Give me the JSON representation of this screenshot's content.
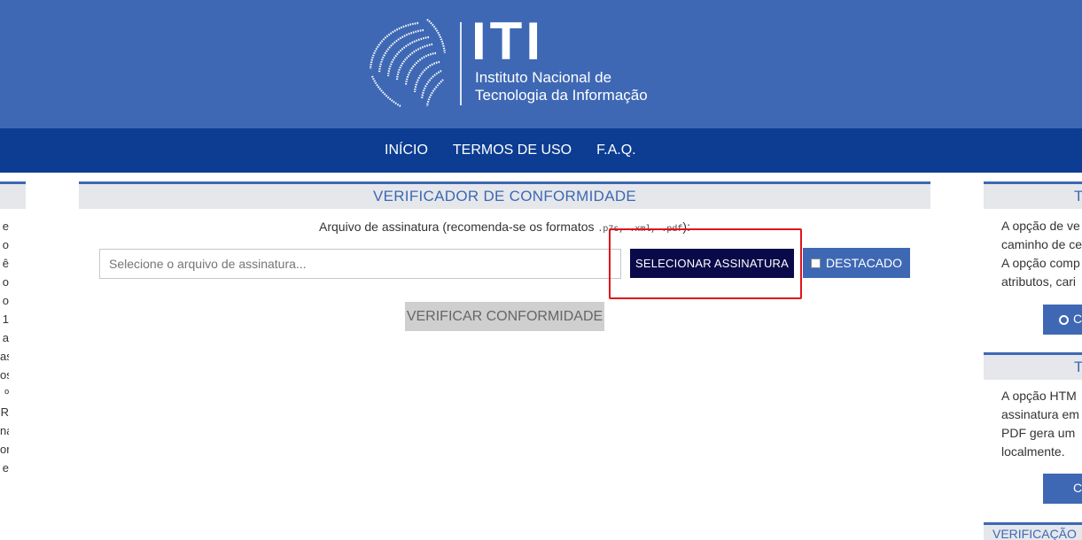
{
  "header": {
    "logo_text": "ITI",
    "logo_subtitle_line1": "Instituto Nacional de",
    "logo_subtitle_line2": "Tecnologia da Informação",
    "bg_color": "#3e68b4"
  },
  "nav": {
    "items": [
      "INÍCIO",
      "TERMOS DE USO",
      "F.A.Q."
    ],
    "bg_color": "#0c3d92"
  },
  "left_panel": {
    "fragments": [
      "e",
      "o",
      "ê",
      "o",
      "o",
      "1",
      "a",
      "as",
      "os",
      "º",
      "R",
      "na",
      "or",
      "e"
    ]
  },
  "main": {
    "title": "VERIFICADOR DE CONFORMIDADE",
    "hint_prefix": "Arquivo de assinatura (recomenda-se os formatos ",
    "hint_formats": ".p7s, .xml, .pdf",
    "hint_suffix": "):",
    "file_placeholder": "Selecione o arquivo de assinatura...",
    "select_button": "SELECIONAR ASSINATURA",
    "detached_label": "DESTACADO",
    "verify_button": "VERIFICAR CONFORMIDADE"
  },
  "right_panel": {
    "header1": "T",
    "text1": [
      "A opção de ve",
      "caminho de ce",
      "A opção comp",
      "atributos, cari"
    ],
    "button1_char": "C",
    "header2": "T",
    "text2": [
      "A opção HTM",
      "assinatura em",
      "PDF gera um",
      "localmente."
    ],
    "button2_char": "C",
    "footer_header": "VERIFICAÇÃO"
  },
  "colors": {
    "accent": "#3e68b4",
    "dark_button": "#0a0a4a",
    "highlight": "#e0141b",
    "disabled": "#cfcfcf"
  }
}
